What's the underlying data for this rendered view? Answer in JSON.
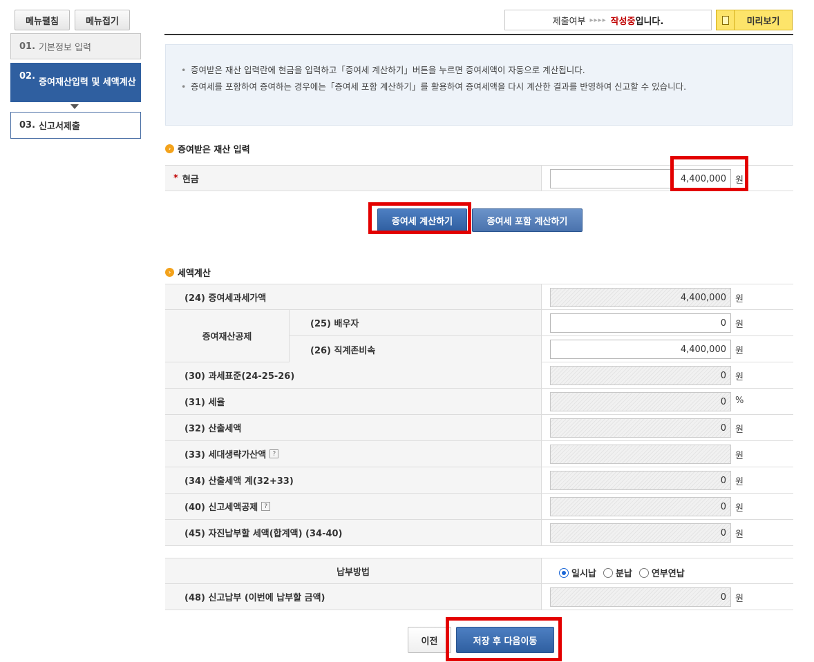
{
  "sidebar": {
    "expand_label": "메뉴펼침",
    "collapse_label": "메뉴접기",
    "steps": [
      {
        "num": "01.",
        "label": "기본정보 입력"
      },
      {
        "num": "02.",
        "label": "증여재산입력 및 세액계산"
      },
      {
        "num": "03.",
        "label": "신고서제출"
      }
    ]
  },
  "status": {
    "label": "제출여부",
    "arrows": "▸▸▸▸",
    "state": "작성중",
    "suffix": "입니다.",
    "preview_label": "미리보기"
  },
  "notice": [
    "증여받은 재산 입력란에 현금을 입력하고「증여세 계산하기」버튼을 누르면 증여세액이 자동으로 계산됩니다.",
    "증여세를 포함하여 증여하는 경우에는「증여세 포함 계산하기」를 활용하여 증여세액을 다시 계산한 결과를 반영하여 신고할 수 있습니다."
  ],
  "property_section": {
    "title": "증여받은 재산 입력",
    "cash_label": "현금",
    "cash_value": "4,400,000",
    "unit": "원"
  },
  "buttons": {
    "calc": "증여세 계산하기",
    "calc_incl": "증여세 포함 계산하기",
    "prev": "이전",
    "save_next": "저장 후 다음이동"
  },
  "tax_section": {
    "title": "세액계산",
    "deduction_group": "증여재산공제",
    "rows": [
      {
        "label": "(24) 증여세과세가액",
        "value": "4,400,000",
        "unit": "원"
      },
      {
        "label": "(25) 배우자",
        "value": "0",
        "unit": "원"
      },
      {
        "label": "(26) 직계존비속",
        "value": "4,400,000",
        "unit": "원"
      },
      {
        "label": "(30) 과세표준(24-25-26)",
        "value": "0",
        "unit": "원"
      },
      {
        "label": "(31) 세율",
        "value": "0",
        "unit": "%"
      },
      {
        "label": "(32) 산출세액",
        "value": "0",
        "unit": "원"
      },
      {
        "label": "(33) 세대생략가산액",
        "value": "",
        "unit": "원"
      },
      {
        "label": "(34) 산출세액 계(32+33)",
        "value": "0",
        "unit": "원"
      },
      {
        "label": "(40) 신고세액공제",
        "value": "0",
        "unit": "원"
      },
      {
        "label": "(45) 자진납부할 세액(합계액) (34-40)",
        "value": "0",
        "unit": "원"
      }
    ]
  },
  "payment": {
    "method_label": "납부방법",
    "options": [
      "일시납",
      "분납",
      "연부연납"
    ],
    "selected": "일시납",
    "report_label": "(48) 신고납부 (이번에 납부할 금액)",
    "report_value": "0",
    "unit": "원"
  }
}
